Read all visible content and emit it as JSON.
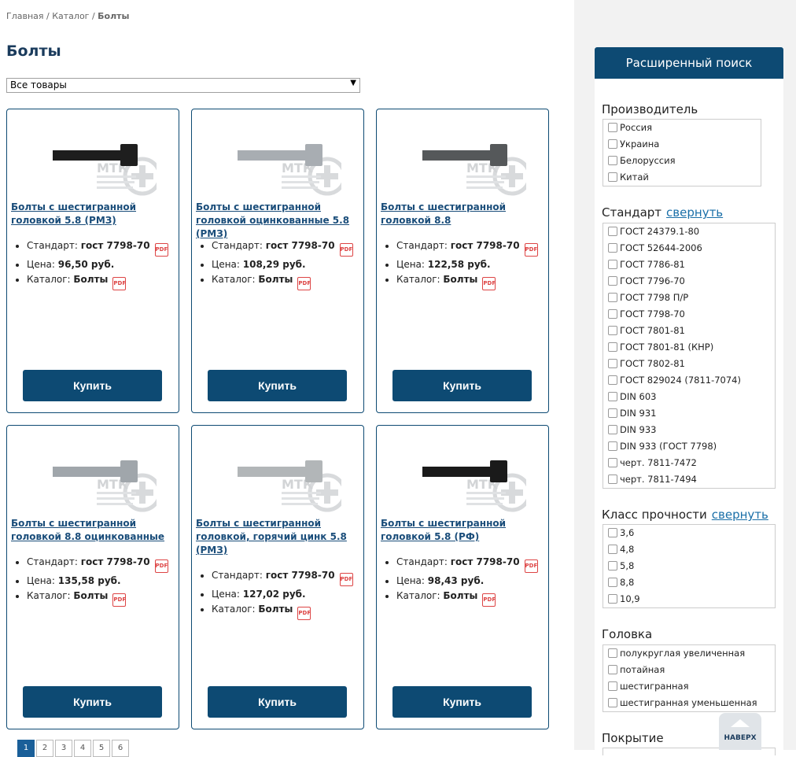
{
  "breadcrumb": {
    "home": "Главная",
    "sep1": " / ",
    "catalog": "Каталог",
    "sep2": " / ",
    "current": "Болты"
  },
  "page_title": "Болты",
  "filter_select": {
    "value": "Все товары"
  },
  "labels": {
    "standard": "Стандарт:",
    "price": "Цена:",
    "catalog": "Каталог:",
    "buy": "Купить",
    "pdf": "PDF"
  },
  "products": [
    {
      "title": "Болты с шестигранной головкой 5.8 (РМЗ)",
      "standard": "гост 7798-70",
      "price": "96,50 руб.",
      "catalog": "Болты",
      "bolt_color": "#1e1e1e"
    },
    {
      "title": "Болты с шестигранной головкой оцинкованные 5.8 (РМЗ)",
      "standard": "гост 7798-70",
      "price": "108,29 руб.",
      "catalog": "Болты",
      "bolt_color": "#a8adb2"
    },
    {
      "title": "Болты с шестигранной головкой 8.8",
      "standard": "гост 7798-70",
      "price": "122,58 руб.",
      "catalog": "Болты",
      "bolt_color": "#55585a"
    },
    {
      "title": "Болты с шестигранной головкой 8.8 оцинкованные",
      "standard": "гост 7798-70",
      "price": "135,58 руб.",
      "catalog": "Болты",
      "bolt_color": "#a0a6ab"
    },
    {
      "title": "Болты с шестигранной головкой, горячий цинк 5.8 (РМЗ)",
      "standard": "гост 7798-70",
      "price": "127,02 руб.",
      "catalog": "Болты",
      "bolt_color": "#b2b6b8"
    },
    {
      "title": "Болты с шестигранной головкой 5.8 (РФ)",
      "standard": "гост 7798-70",
      "price": "98,43 руб.",
      "catalog": "Болты",
      "bolt_color": "#1a1a1a"
    }
  ],
  "watermark": "МТК",
  "pagination": [
    "1",
    "2",
    "3",
    "4",
    "5",
    "6"
  ],
  "sidebar": {
    "title": "Расширенный поиск",
    "collapse_label": "свернуть",
    "groups": [
      {
        "title": "Производитель",
        "options": [
          "Россия",
          "Украина",
          "Белоруссия",
          "Китай"
        ]
      },
      {
        "title": "Стандарт",
        "options": [
          "ГОСТ 24379.1-80",
          "ГОСТ 52644-2006",
          "ГОСТ 7786-81",
          "ГОСТ 7796-70",
          "ГОСТ 7798 П/Р",
          "ГОСТ 7798-70",
          "ГОСТ 7801-81",
          "ГОСТ 7801-81 (КНР)",
          "ГОСТ 7802-81",
          "ГОСТ 829024 (7811-7074)",
          "DIN 603",
          "DIN 931",
          "DIN 933",
          "DIN 933 (ГОСТ 7798)",
          "черт. 7811-7472",
          "черт. 7811-7494"
        ]
      },
      {
        "title": "Класс прочности",
        "options": [
          "3,6",
          "4,8",
          "5,8",
          "8,8",
          "10,9"
        ]
      },
      {
        "title": "Головка",
        "options": [
          "полукруглая увеличенная",
          "потайная",
          "шестигранная",
          "шестигранная уменьшенная"
        ]
      },
      {
        "title": "Покрытие",
        "options": []
      }
    ]
  },
  "to_top": "НАВЕРХ",
  "colors": {
    "accent": "#0d4a73",
    "link": "#1a4d7a",
    "pdf": "#d44444"
  }
}
